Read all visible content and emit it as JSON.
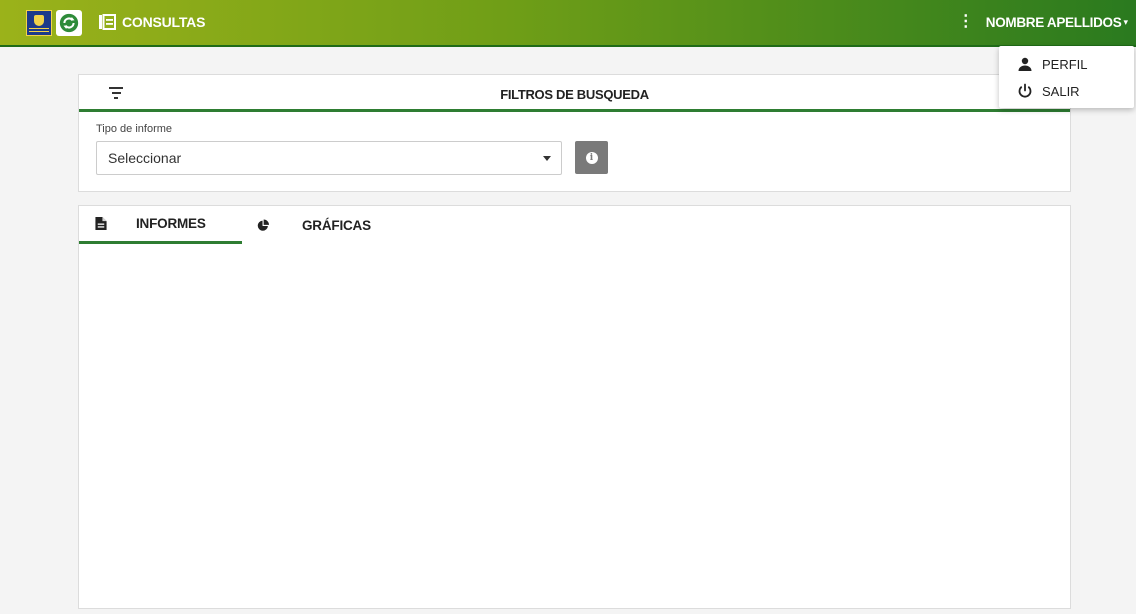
{
  "header": {
    "nav_label": "CONSULTAS",
    "user_name": "NOMBRE APELLIDOS",
    "colors": {
      "bar_start": "#9bb21a",
      "bar_end": "#2a7a1f",
      "accent": "#2e7d32"
    }
  },
  "user_menu": {
    "items": [
      {
        "label": "PERFIL",
        "icon": "person-icon"
      },
      {
        "label": "SALIR",
        "icon": "power-icon"
      }
    ]
  },
  "filters": {
    "title": "FILTROS DE BUSQUEDA",
    "tipo_label": "Tipo de informe",
    "tipo_value": "Seleccionar"
  },
  "tabs": [
    {
      "label": "INFORMES",
      "icon": "document-icon",
      "active": true
    },
    {
      "label": "GRÁFICAS",
      "icon": "pie-chart-icon",
      "active": false
    }
  ]
}
